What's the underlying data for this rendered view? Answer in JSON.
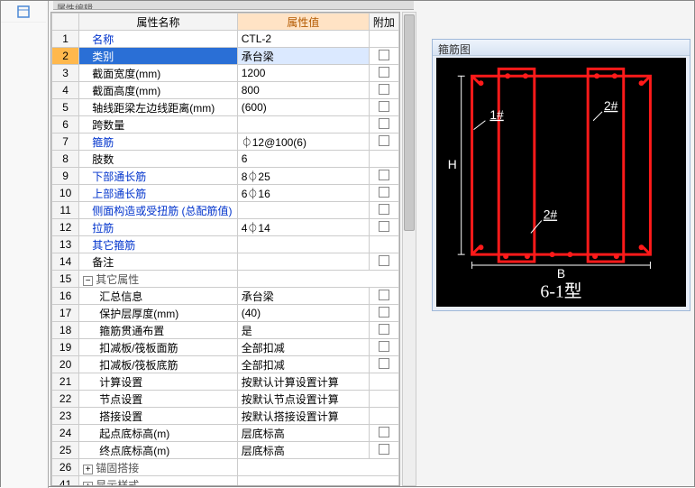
{
  "tab_label": "属性编辑",
  "columns": {
    "name": "属性名称",
    "value": "属性值",
    "extra": "附加"
  },
  "rows": [
    {
      "n": 1,
      "name": "名称",
      "value": "CTL-2",
      "link": true,
      "chk": false
    },
    {
      "n": 2,
      "name": "类别",
      "value": "承台梁",
      "link": true,
      "chk": true,
      "selected": true
    },
    {
      "n": 3,
      "name": "截面宽度(mm)",
      "value": "1200",
      "chk": true
    },
    {
      "n": 4,
      "name": "截面高度(mm)",
      "value": "800",
      "chk": true
    },
    {
      "n": 5,
      "name": "轴线距梁左边线距离(mm)",
      "value": "(600)",
      "chk": true
    },
    {
      "n": 6,
      "name": "跨数量",
      "value": "",
      "chk": true
    },
    {
      "n": 7,
      "name": "箍筋",
      "value": "⏀12@100(6)",
      "link": true,
      "chk": true
    },
    {
      "n": 8,
      "name": "肢数",
      "value": "6",
      "chk": false
    },
    {
      "n": 9,
      "name": "下部通长筋",
      "value": "8⏀25",
      "link": true,
      "chk": true
    },
    {
      "n": 10,
      "name": "上部通长筋",
      "value": "6⏀16",
      "link": true,
      "chk": true
    },
    {
      "n": 11,
      "name": "侧面构造或受扭筋 (总配筋值)",
      "value": "",
      "link": true,
      "chk": true
    },
    {
      "n": 12,
      "name": "拉筋",
      "value": "4⏀14",
      "link": true,
      "chk": true
    },
    {
      "n": 13,
      "name": "其它箍筋",
      "value": "",
      "link": true,
      "chk": false
    },
    {
      "n": 14,
      "name": "备注",
      "value": "",
      "chk": true
    },
    {
      "n": 15,
      "name": "其它属性",
      "value": "",
      "group": true,
      "exp": "−"
    },
    {
      "n": 16,
      "name": "汇总信息",
      "value": "承台梁",
      "indent": 2,
      "chk": true
    },
    {
      "n": 17,
      "name": "保护层厚度(mm)",
      "value": "(40)",
      "indent": 2,
      "chk": true
    },
    {
      "n": 18,
      "name": "箍筋贯通布置",
      "value": "是",
      "indent": 2,
      "chk": true
    },
    {
      "n": 19,
      "name": "扣减板/筏板面筋",
      "value": "全部扣减",
      "indent": 2,
      "chk": true
    },
    {
      "n": 20,
      "name": "扣减板/筏板底筋",
      "value": "全部扣减",
      "indent": 2,
      "chk": true
    },
    {
      "n": 21,
      "name": "计算设置",
      "value": "按默认计算设置计算",
      "indent": 2,
      "chk": false
    },
    {
      "n": 22,
      "name": "节点设置",
      "value": "按默认节点设置计算",
      "indent": 2,
      "chk": false
    },
    {
      "n": 23,
      "name": "搭接设置",
      "value": "按默认搭接设置计算",
      "indent": 2,
      "chk": false
    },
    {
      "n": 24,
      "name": "起点底标高(m)",
      "value": "层底标高",
      "indent": 2,
      "chk": true
    },
    {
      "n": 25,
      "name": "终点底标高(m)",
      "value": "层底标高",
      "indent": 2,
      "chk": true
    },
    {
      "n": 26,
      "name": "锚固搭接",
      "value": "",
      "group": true,
      "exp": "+"
    },
    {
      "n": 41,
      "name": "显示样式",
      "value": "",
      "group": true,
      "exp": "+"
    }
  ],
  "diagram": {
    "title": "箍筋图",
    "label_h": "H",
    "label_b": "B",
    "type_label": "6-1型",
    "ann1": "1#",
    "ann2a": "2#",
    "ann2b": "2#"
  }
}
